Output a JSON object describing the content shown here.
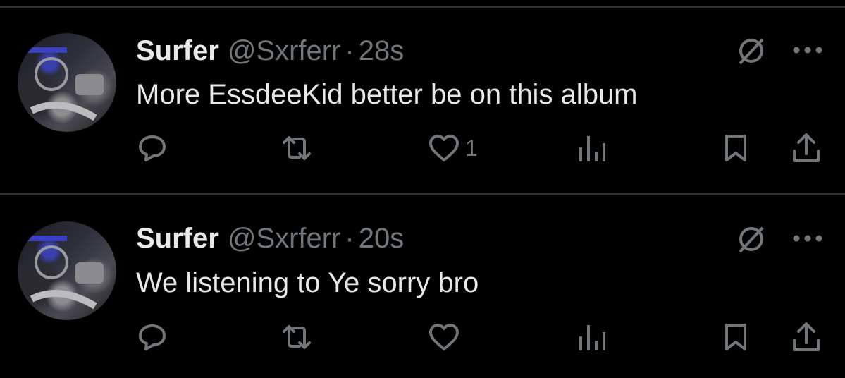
{
  "tweets": [
    {
      "name": "Surfer",
      "handle": "@Sxrferr",
      "separator": "·",
      "time": "28s",
      "text": "More EssdeeKid better be on this album",
      "likes": "1",
      "icons": [
        "reply-icon",
        "retweet-icon",
        "like-icon",
        "views-icon",
        "bookmark-icon",
        "share-icon",
        "grok-icon",
        "more-icon"
      ]
    },
    {
      "name": "Surfer",
      "handle": "@Sxrferr",
      "separator": "·",
      "time": "20s",
      "text": "We listening to Ye sorry bro",
      "likes": "",
      "icons": [
        "reply-icon",
        "retweet-icon",
        "like-icon",
        "views-icon",
        "bookmark-icon",
        "share-icon",
        "grok-icon",
        "more-icon"
      ]
    }
  ],
  "colors": {
    "background": "#000000",
    "primary_text": "#e7e9ea",
    "secondary_text": "#71767b",
    "divider": "#2f3336"
  }
}
